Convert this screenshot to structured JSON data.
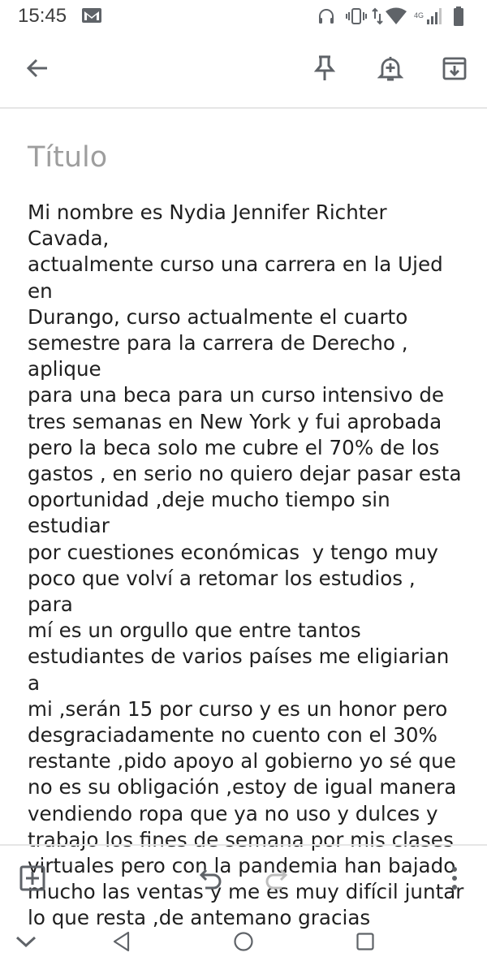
{
  "status_bar": {
    "time": "15:45",
    "network_label": "4G"
  },
  "note": {
    "title_placeholder": "Título",
    "body": "Mi nombre es Nydia Jennifer Richter Cavada,\nactualmente curso una carrera en la Ujed en\nDurango, curso actualmente el cuarto\nsemestre para la carrera de Derecho , aplique\npara una beca para un curso intensivo de\ntres semanas en New York y fui aprobada\npero la beca solo me cubre el 70% de los\ngastos , en serio no quiero dejar pasar esta\noportunidad ,deje mucho tiempo sin estudiar\npor cuestiones económicas  y tengo muy\npoco que volví a retomar los estudios , para\nmí es un orgullo que entre tantos\nestudiantes de varios países me eligiarian a\nmi ,serán 15 por curso y es un honor pero\ndesgraciadamente no cuento con el 30%\nrestante ,pido apoyo al gobierno yo sé que\nno es su obligación ,estoy de igual manera\nvendiendo ropa que ya no uso y dulces y\ntrabajo los fines de semana por mis clases\nvirtuales pero con la pandemia han bajado\nmucho las ventas y me es muy difícil juntar\nlo que resta ,de antemano gracias"
  },
  "icons": {
    "back": "arrow-left-icon",
    "pin": "pin-icon",
    "reminder": "bell-plus-icon",
    "archive": "archive-icon",
    "add": "add-box-icon",
    "undo": "undo-icon",
    "redo": "redo-icon",
    "more": "more-vert-icon"
  },
  "colors": {
    "icon": "#5f6368",
    "icon_disabled": "#bdbdbd",
    "placeholder": "#9e9e9e",
    "text": "#1f1f1f",
    "divider": "#e6e6e6"
  }
}
